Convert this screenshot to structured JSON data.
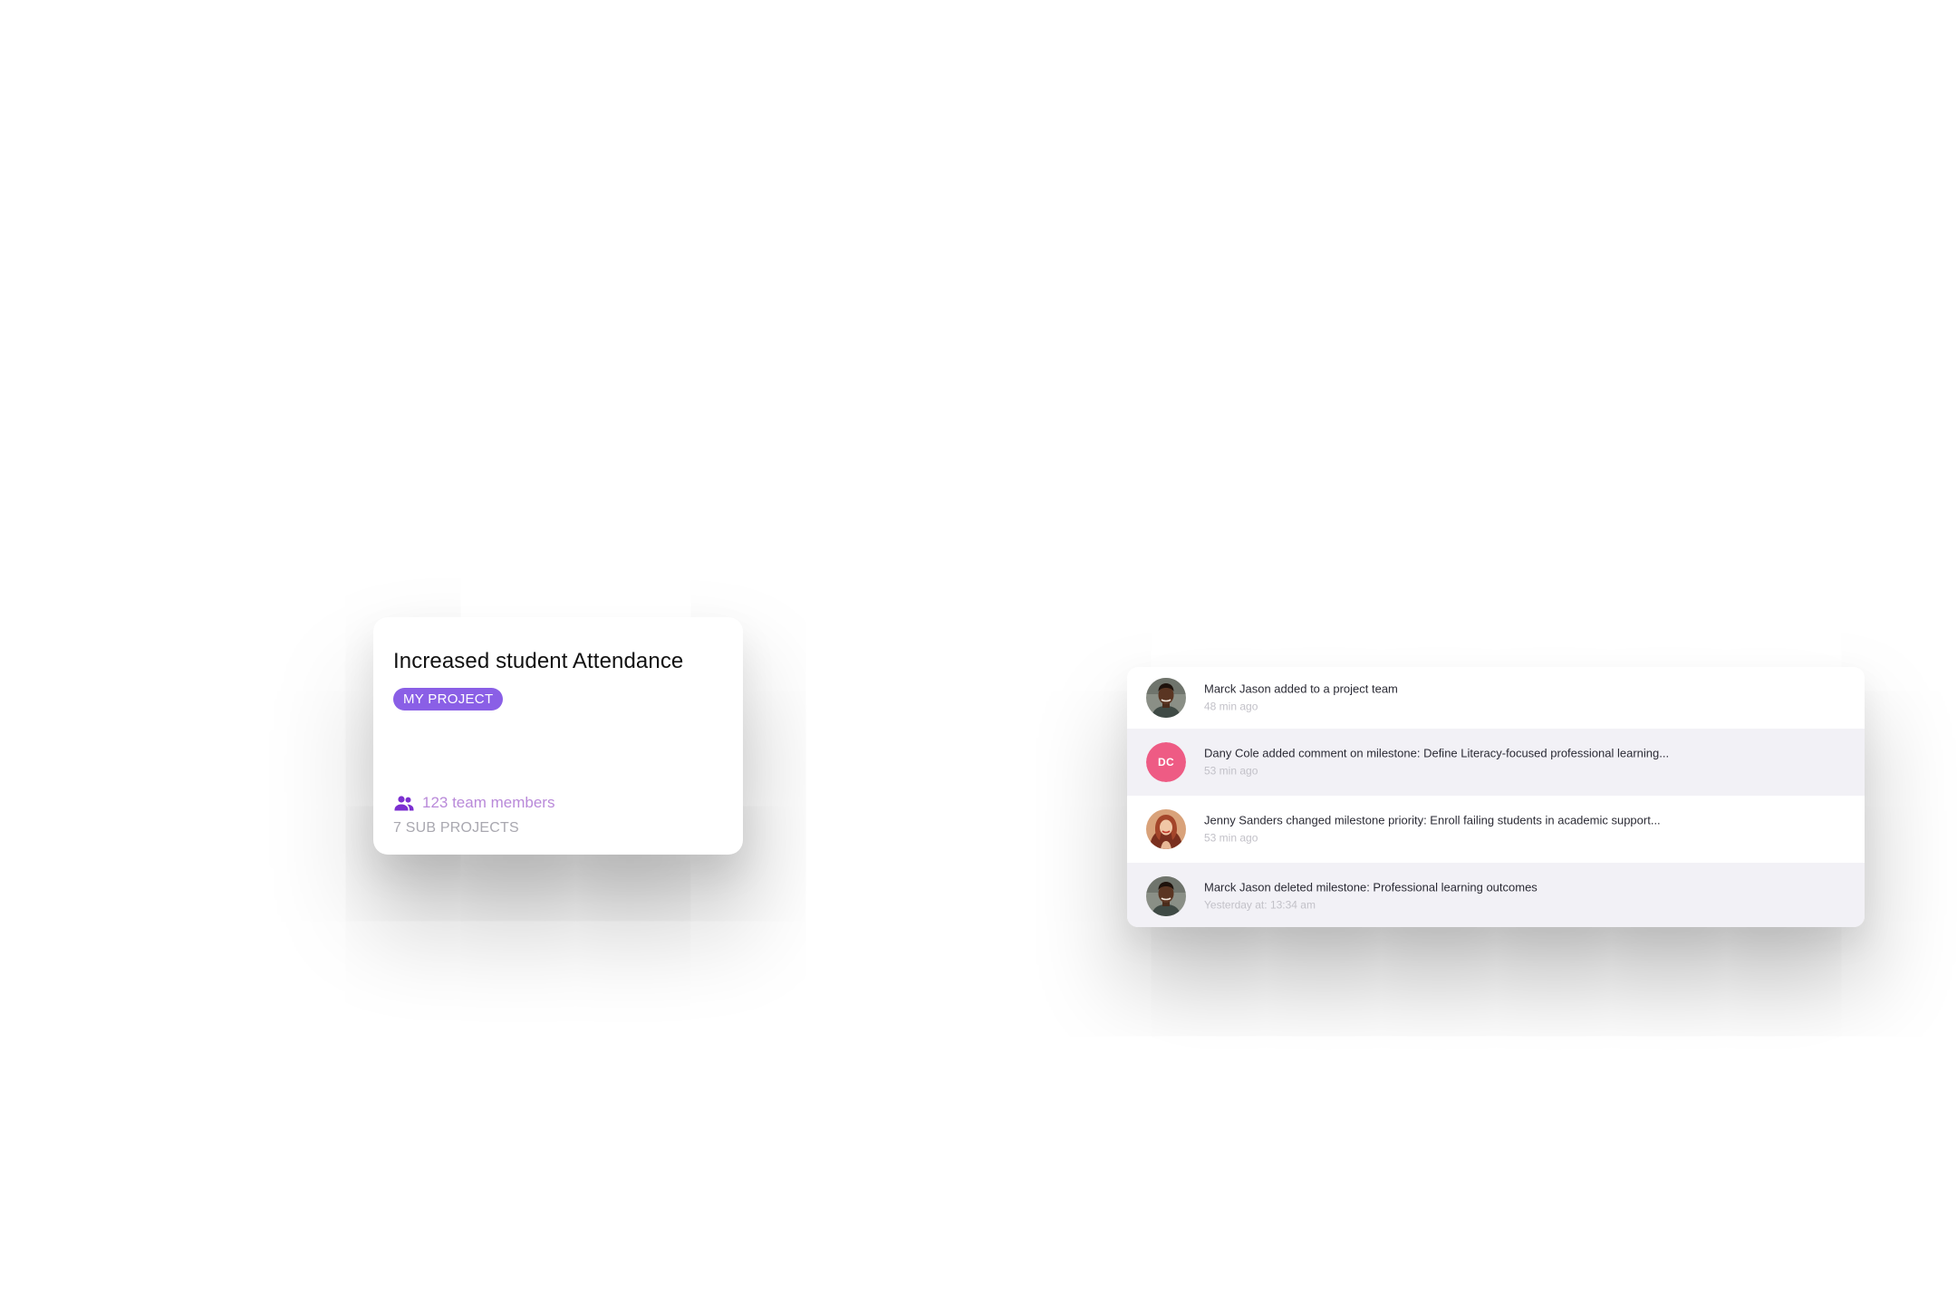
{
  "project_card": {
    "title": "Increased student Attendance",
    "badge": "MY PROJECT",
    "team_members": "123 team members",
    "sub_projects": "7 SUB PROJECTS",
    "team_icon": "people-icon",
    "colors": {
      "badge": "#8a5fe6",
      "team_members": "#b989d9",
      "team_icon": "#7b2fd0"
    }
  },
  "activity_feed": {
    "items": [
      {
        "message": "Marck Jason added to a project team",
        "time": "48 min ago",
        "avatar": "marck-jason-photo"
      },
      {
        "message": "Dany Cole added comment on milestone: Define Literacy-focused professional learning...",
        "time": "53 min ago",
        "avatar_initials": "DC",
        "avatar_color": "#ee5b84"
      },
      {
        "message": "Jenny Sanders changed milestone priority: Enroll failing students in academic support...",
        "time": "53 min ago",
        "avatar": "jenny-sanders-photo"
      },
      {
        "message": "Marck Jason deleted milestone: Professional learning outcomes",
        "time": "Yesterday at: 13:34 am",
        "avatar": "marck-jason-photo"
      }
    ]
  }
}
